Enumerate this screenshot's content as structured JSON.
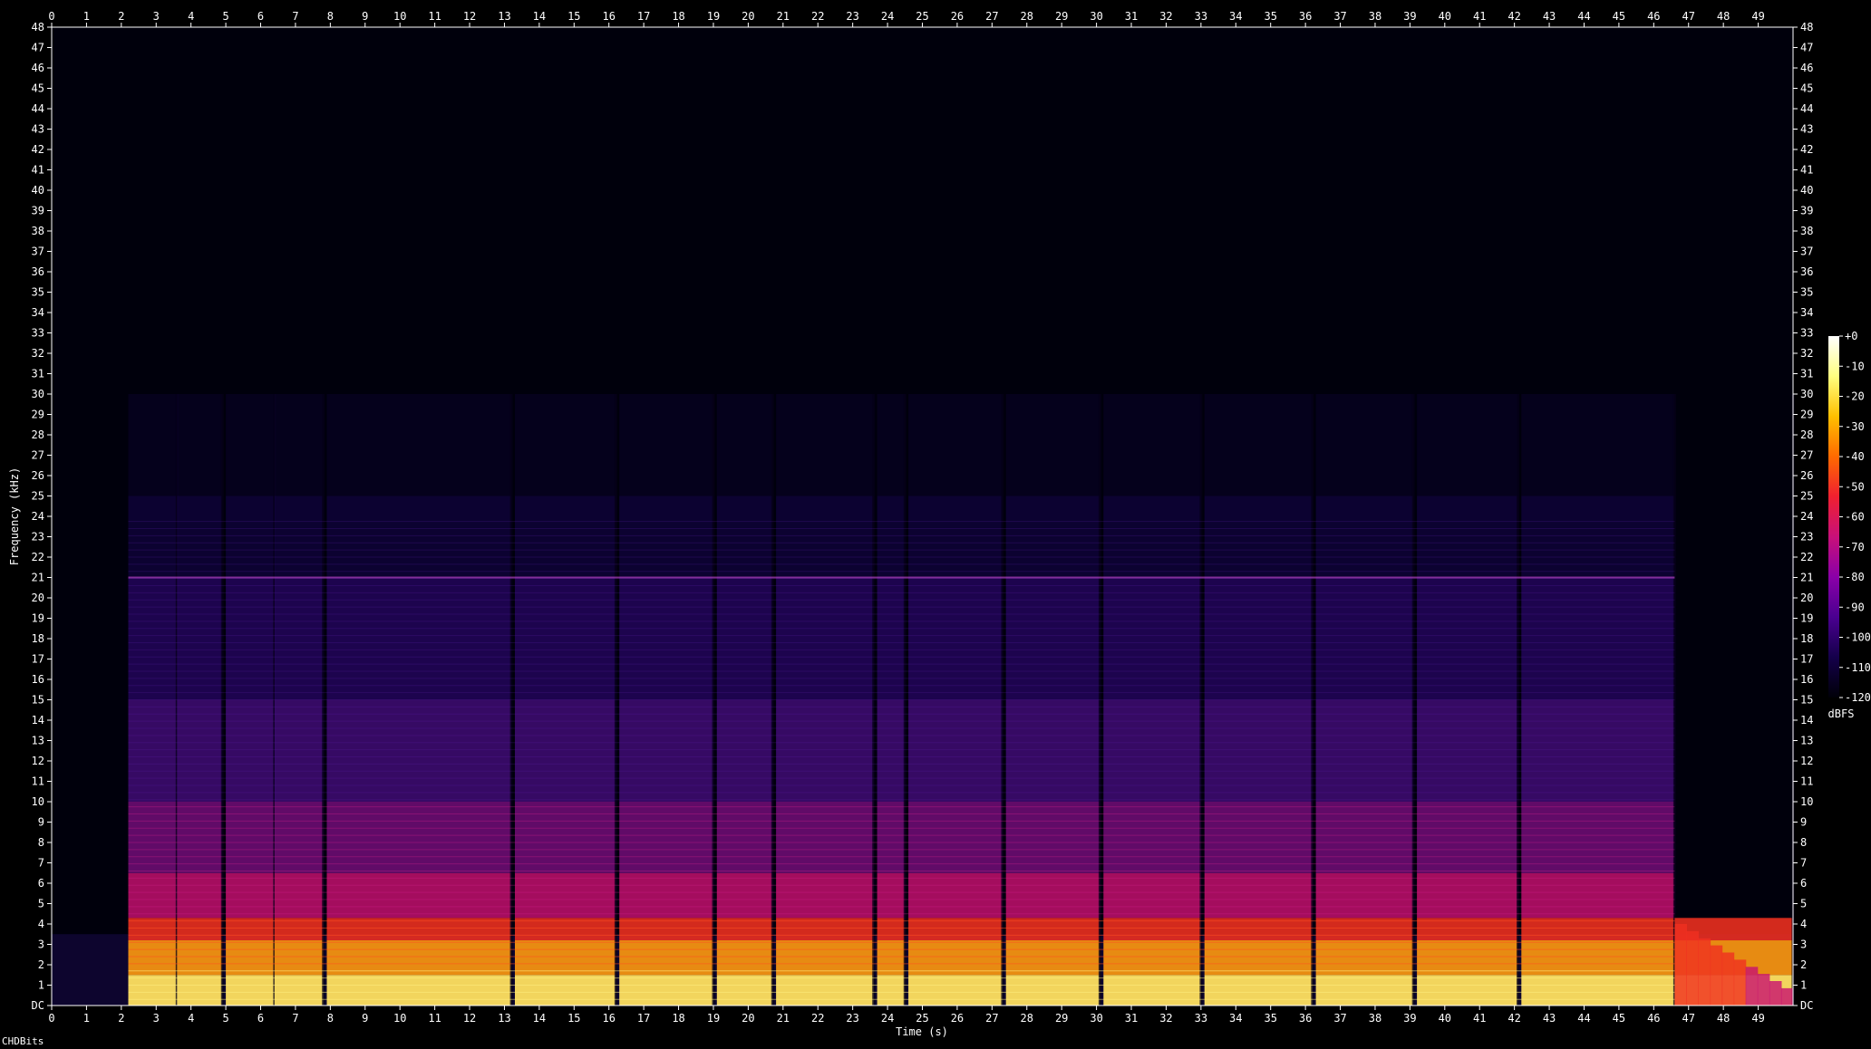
{
  "app_name": "CHDBits",
  "chart_data": {
    "type": "heatmap",
    "subtype": "spectrogram",
    "xlabel": "Time (s)",
    "ylabel": "Frequency (kHz)",
    "x_ticks": [
      "0",
      "1",
      "2",
      "3",
      "4",
      "5",
      "6",
      "7",
      "8",
      "9",
      "10",
      "11",
      "12",
      "13",
      "14",
      "15",
      "16",
      "17",
      "18",
      "19",
      "20",
      "21",
      "22",
      "23",
      "24",
      "25",
      "26",
      "27",
      "28",
      "29",
      "30",
      "31",
      "32",
      "33",
      "34",
      "35",
      "36",
      "37",
      "38",
      "39",
      "40",
      "41",
      "42",
      "43",
      "44",
      "45",
      "46",
      "47",
      "48",
      "49"
    ],
    "y_ticks": [
      "DC",
      "1",
      "2",
      "3",
      "4",
      "5",
      "6",
      "7",
      "8",
      "9",
      "10",
      "11",
      "12",
      "13",
      "14",
      "15",
      "16",
      "17",
      "18",
      "19",
      "20",
      "21",
      "22",
      "23",
      "24",
      "25",
      "26",
      "27",
      "28",
      "29",
      "30",
      "31",
      "32",
      "33",
      "34",
      "35",
      "36",
      "37",
      "38",
      "39",
      "40",
      "41",
      "42",
      "43",
      "44",
      "45",
      "46",
      "47",
      "48"
    ],
    "xlim": [
      0,
      50
    ],
    "ylim": [
      0,
      48
    ],
    "x_unit": "s",
    "y_unit": "kHz",
    "colorbar": {
      "label": "dBFS",
      "ticks": [
        "+0",
        "-10",
        "-20",
        "-30",
        "-40",
        "-50",
        "-60",
        "-70",
        "-80",
        "-90",
        "-100",
        "-110",
        "-120"
      ],
      "range": [
        -120,
        0
      ],
      "colors": [
        "#000008",
        "#14004a",
        "#4a0090",
        "#8a00a8",
        "#c8107a",
        "#f02030",
        "#ff6a00",
        "#ffc000",
        "#ffff80",
        "#ffffff"
      ]
    },
    "signal_segments_s": [
      [
        2.2,
        3.6
      ],
      [
        3.6,
        4.9
      ],
      [
        5.0,
        6.4
      ],
      [
        6.4,
        7.8
      ],
      [
        7.9,
        13.2
      ],
      [
        13.3,
        16.2
      ],
      [
        16.3,
        19.0
      ],
      [
        19.1,
        20.7
      ],
      [
        20.8,
        23.6
      ],
      [
        23.7,
        24.5
      ],
      [
        24.6,
        27.3
      ],
      [
        27.4,
        30.1
      ],
      [
        30.2,
        33.0
      ],
      [
        33.1,
        36.2
      ],
      [
        36.3,
        39.1
      ],
      [
        39.2,
        42.1
      ],
      [
        42.2,
        46.6
      ],
      [
        46.6,
        50.0
      ]
    ],
    "background_noise_floor_dbfs": -115,
    "tonal_lines_khz": [
      21
    ]
  }
}
